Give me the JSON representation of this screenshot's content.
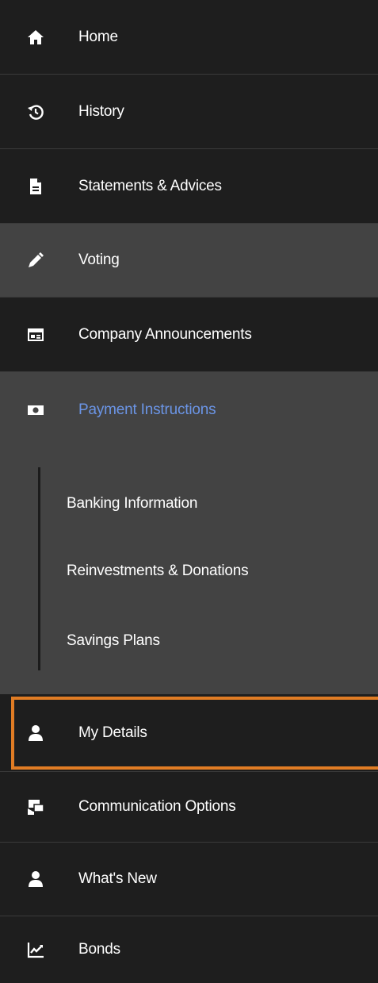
{
  "nav": {
    "items": [
      {
        "label": "Home",
        "icon": "home-icon"
      },
      {
        "label": "History",
        "icon": "history-icon"
      },
      {
        "label": "Statements & Advices",
        "icon": "document-icon"
      },
      {
        "label": "Voting",
        "icon": "pen-icon"
      },
      {
        "label": "Company Announcements",
        "icon": "announcement-icon"
      },
      {
        "label": "Payment Instructions",
        "icon": "money-icon"
      },
      {
        "label": "My Details",
        "icon": "user-icon"
      },
      {
        "label": "Communication Options",
        "icon": "communication-icon"
      },
      {
        "label": "What's New",
        "icon": "user-icon"
      },
      {
        "label": "Bonds",
        "icon": "chart-line-icon"
      }
    ],
    "payment_submenu": [
      {
        "label": "Banking Information"
      },
      {
        "label": "Reinvestments & Donations"
      },
      {
        "label": "Savings Plans"
      }
    ]
  },
  "colors": {
    "active_text": "#6b95e6",
    "focus_border": "#e07c24",
    "dark_row": "#1e1e1e",
    "gray_row": "#434343"
  }
}
